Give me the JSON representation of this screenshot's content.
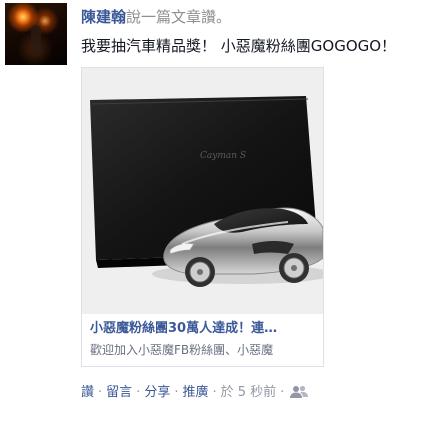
{
  "post": {
    "author": "陳建翰",
    "action_text": "說一篇文章讚。",
    "message": "我要抽汽車精品獎！ 小惡魔粉絲團GOGOGO！",
    "shared_card": {
      "image_alt": "car model product photo",
      "title": "小惡魔粉絲團30萬人達成！連…",
      "description": "歡迎加入小惡魔FB粉絲團、小惡魔",
      "box_logo": "Cayman S"
    },
    "actions": {
      "like": "讚",
      "comment": "留言",
      "share": "分享",
      "promote": "推廣",
      "timestamp": "於 5 秒前",
      "audience_icon": "friends-icon"
    },
    "colors": {
      "link_blue": "#3b5998",
      "meta_gray": "#9197a3",
      "text": "#141823"
    }
  }
}
